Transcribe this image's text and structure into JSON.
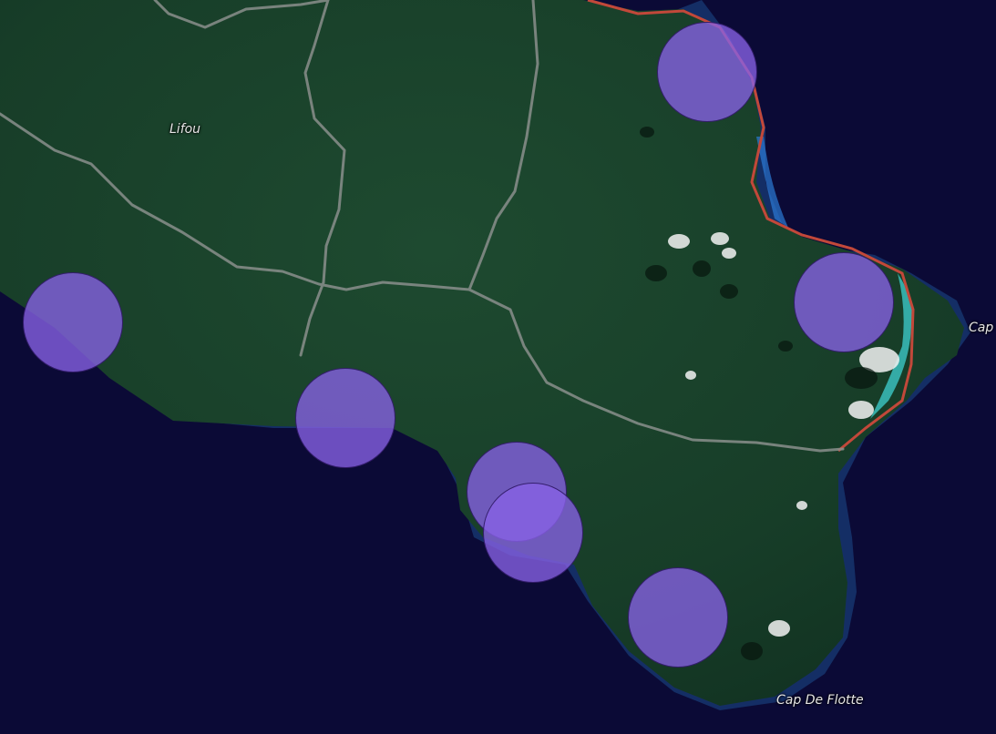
{
  "labels": {
    "lifou": "Lifou",
    "cap": "Cap",
    "cap_de_flotte": "Cap De Flotte"
  },
  "colors": {
    "ocean": "#0b0a36",
    "land": "#19422a",
    "road": "#8a8f8c",
    "marker_fill": "#8862e6",
    "boundary": "#c2483a"
  },
  "markers": [
    {
      "id": "marker-northeast"
    },
    {
      "id": "marker-east-cape"
    },
    {
      "id": "marker-west-coast"
    },
    {
      "id": "marker-south-coast-1"
    },
    {
      "id": "marker-south-coast-2"
    },
    {
      "id": "marker-south-coast-3"
    },
    {
      "id": "marker-southeast"
    }
  ]
}
